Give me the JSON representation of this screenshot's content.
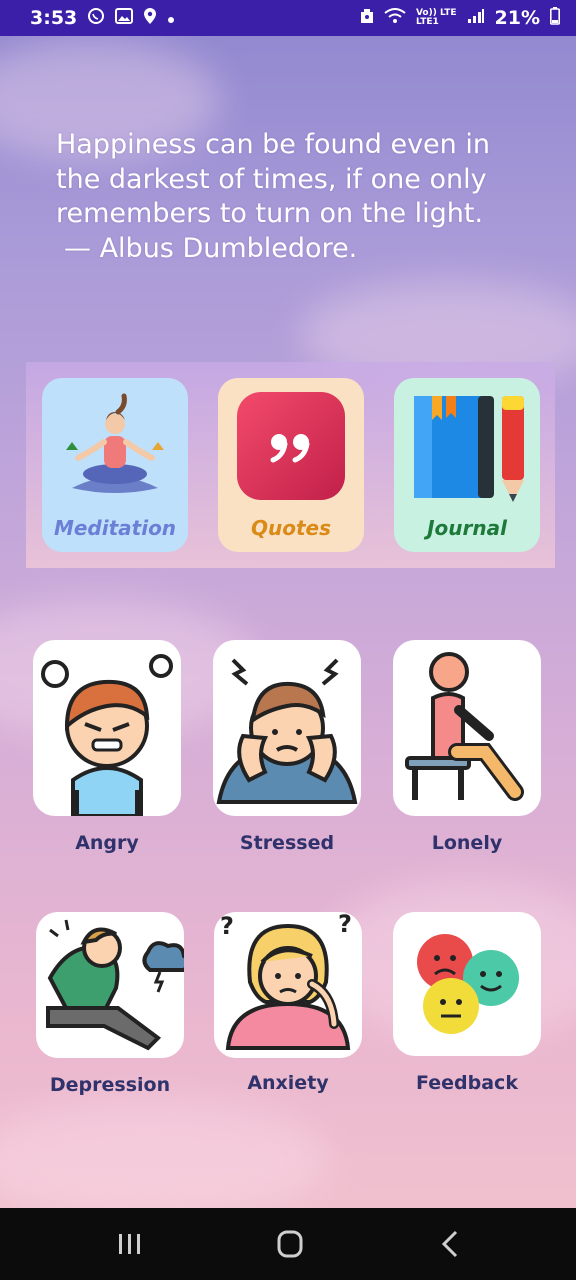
{
  "status_bar": {
    "time": "3:53",
    "left_icons": [
      "whatsapp-icon",
      "gallery-icon",
      "location-icon",
      "dot-icon"
    ],
    "network_label_top": "Vo)) LTE",
    "network_label_bottom": "LTE1",
    "battery": "21%"
  },
  "quote": {
    "line1": "Happiness can be found even in",
    "line2": "the darkest of times, if one only",
    "line3": "remembers to turn on the light.",
    "line4": "— Albus Dumbledore."
  },
  "tools": [
    {
      "label": "Meditation",
      "bg": "#bfe0fb",
      "color": "#6c7fd6"
    },
    {
      "label": "Quotes",
      "bg": "#fbe1c4",
      "color": "#d98a17"
    },
    {
      "label": "Journal",
      "bg": "#c9f1e2",
      "color": "#1e7a3a"
    }
  ],
  "moods": [
    {
      "label": "Angry"
    },
    {
      "label": "Stressed"
    },
    {
      "label": "Lonely"
    },
    {
      "label": "Depression"
    },
    {
      "label": "Anxiety"
    },
    {
      "label": "Feedback"
    }
  ],
  "colors": {
    "status_bar": "#3b1fa8",
    "mood_label": "#30336b",
    "nav_bar": "#0c0c0c"
  }
}
